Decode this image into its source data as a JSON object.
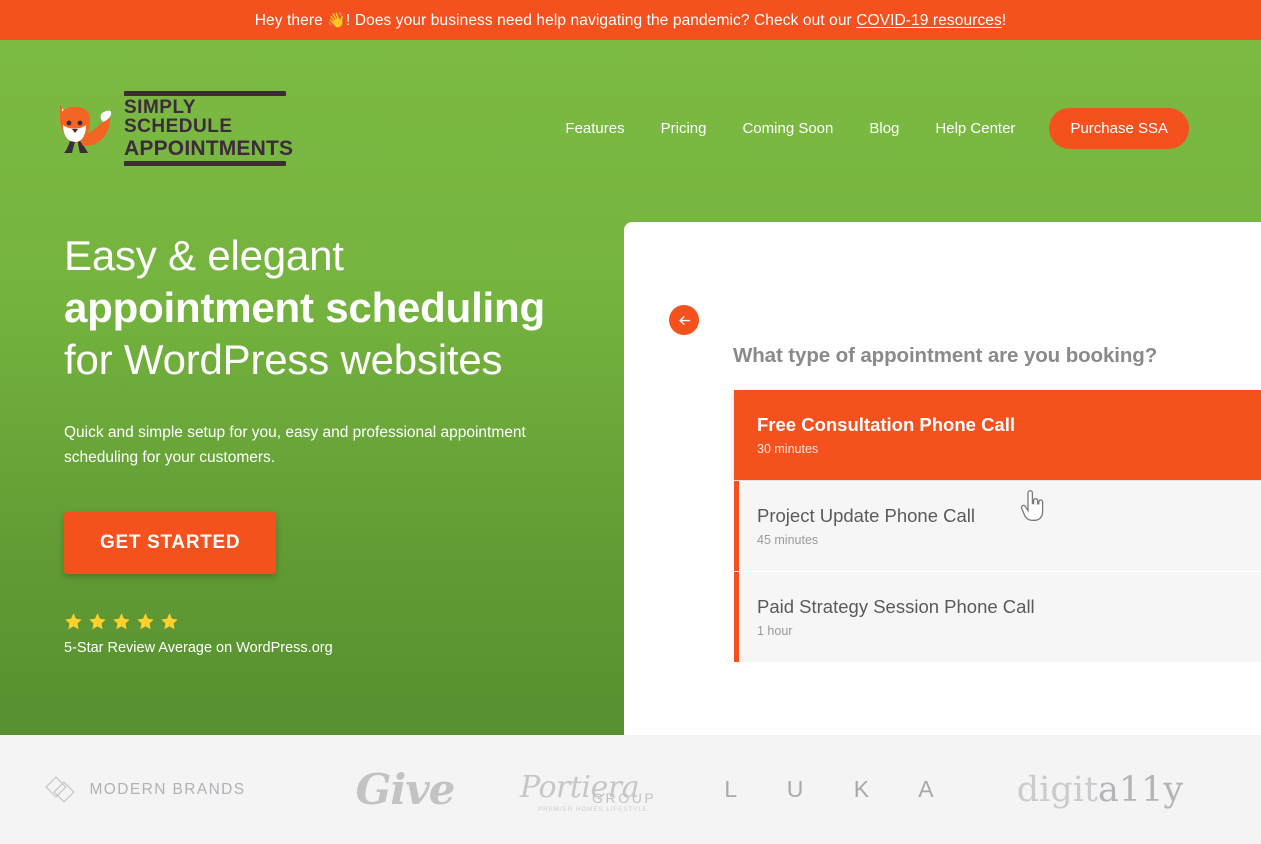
{
  "notice": {
    "text_before": "Hey there ",
    "emoji": "👋",
    "text_middle": "! Does your business need help navigating the pandemic? Check out our ",
    "link_label": "COVID-19 resources",
    "text_after": "!",
    "background_color": "#f4511e"
  },
  "header": {
    "logo": {
      "line1": "SIMPLY SCHEDULE",
      "line2": "APPOINTMENTS",
      "icon": "fox-logo-icon"
    },
    "nav": [
      {
        "label": "Features"
      },
      {
        "label": "Pricing"
      },
      {
        "label": "Coming Soon"
      },
      {
        "label": "Blog"
      },
      {
        "label": "Help Center"
      }
    ],
    "cta": {
      "label": "Purchase SSA",
      "color": "#f4511e"
    }
  },
  "hero": {
    "title_part1": "Easy & elegant ",
    "title_bold": "appointment scheduling",
    "title_part2": " for WordPress websites",
    "subtitle": "Quick and simple setup for you, easy and professional appointment scheduling for your customers.",
    "cta_label": "GET STARTED",
    "rating": {
      "stars": 5,
      "star_color": "#ffd02e",
      "text": "5-Star Review Average on WordPress.org"
    },
    "background_gradient": [
      "#7cba43",
      "#56902f"
    ]
  },
  "booking_card": {
    "back_button": "back-arrow-icon",
    "question": "What type of appointment are you booking?",
    "options": [
      {
        "name": "Free Consultation Phone Call",
        "duration": "30 minutes",
        "selected": true
      },
      {
        "name": "Project Update Phone Call",
        "duration": "45 minutes",
        "selected": false
      },
      {
        "name": "Paid Strategy Session Phone Call",
        "duration": "1 hour",
        "selected": false
      }
    ],
    "accent_color": "#f4511e"
  },
  "client_logos": [
    {
      "name": "MODERN BRANDS",
      "icon": "diamond-icon"
    },
    {
      "name": "Give"
    },
    {
      "name": "Portiera",
      "suffix": "GROUP",
      "tagline": "PREMIER HOMES LIFESTYLE"
    },
    {
      "name": "L U K A"
    },
    {
      "name_part1": "digit",
      "name_part2": "a11y"
    }
  ]
}
